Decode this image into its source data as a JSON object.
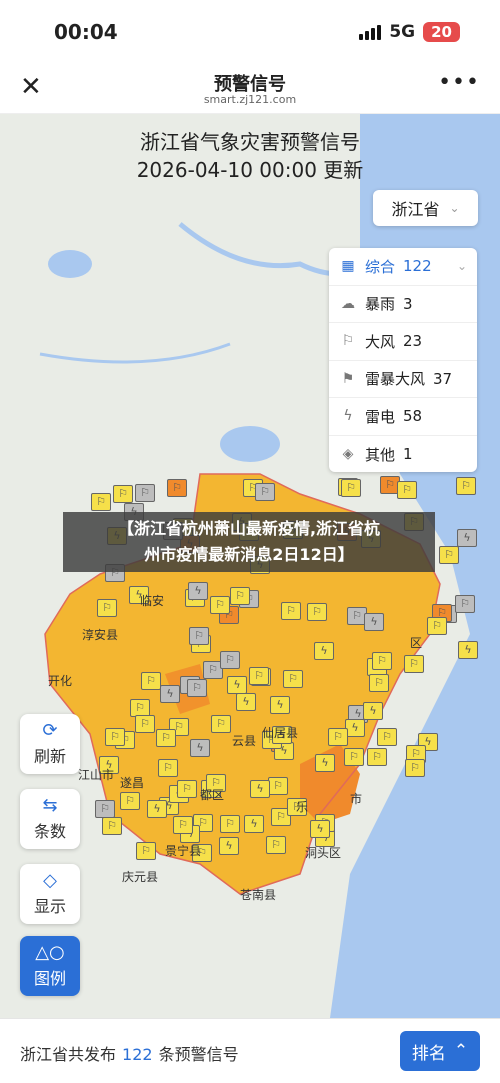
{
  "status_bar": {
    "time": "00:04",
    "network": "5G",
    "battery": "20"
  },
  "nav": {
    "title": "预警信号",
    "subtitle": "smart.zj121.com"
  },
  "map": {
    "title_line1": "浙江省气象灾害预警信号",
    "title_line2": "2026-04-10 00:00 更新",
    "province": "浙江省",
    "legend": [
      {
        "label": "综合",
        "count": "122",
        "icon": "grid-icon"
      },
      {
        "label": "暴雨",
        "count": "3",
        "icon": "rain-icon"
      },
      {
        "label": "大风",
        "count": "23",
        "icon": "wind-flag-icon"
      },
      {
        "label": "雷暴大风",
        "count": "37",
        "icon": "thunder-wind-icon"
      },
      {
        "label": "雷电",
        "count": "58",
        "icon": "lightning-icon"
      },
      {
        "label": "其他",
        "count": "1",
        "icon": "other-icon"
      }
    ],
    "banner_line1": "【浙江省杭州萧山最新疫情,浙江省杭",
    "banner_line2": "州市疫情最新消息2日12日】",
    "place_labels": [
      "临安",
      "淳安县",
      "开化",
      "江山市",
      "遂昌",
      "都区",
      "云县",
      "仙居县",
      "景宁县",
      "庆元县",
      "苍南县",
      "洞头区",
      "乐",
      "市",
      "区"
    ],
    "tools": [
      {
        "label": "刷新",
        "icon": "refresh-icon"
      },
      {
        "label": "条数",
        "icon": "swap-icon"
      },
      {
        "label": "显示",
        "icon": "layers-icon"
      },
      {
        "label": "图例",
        "icon": "legend-icon"
      }
    ],
    "colors": {
      "yellow_region": "#f3b631",
      "orange_region": "#f08a2c",
      "sea": "#a9c8ef",
      "land": "#e9ece6"
    }
  },
  "footer": {
    "prefix": "浙江省共发布",
    "count": "122",
    "suffix": "条预警信号",
    "rank_button": "排名"
  }
}
